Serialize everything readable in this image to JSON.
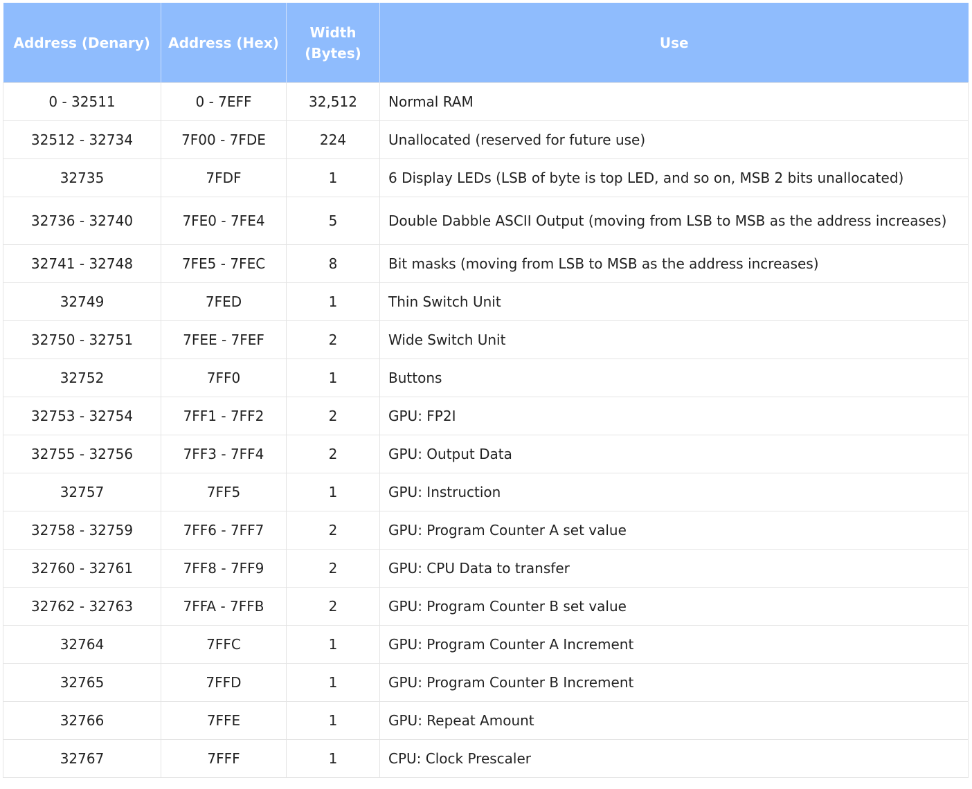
{
  "table": {
    "headers": {
      "denary": "Address (Denary)",
      "hex": "Address (Hex)",
      "width_line1": "Width",
      "width_line2": "(Bytes)",
      "use": "Use"
    },
    "rows": [
      {
        "denary": "0 - 32511",
        "hex": "0 - 7EFF",
        "width": "32,512",
        "use": "Normal RAM"
      },
      {
        "denary": "32512 - 32734",
        "hex": "7F00 - 7FDE",
        "width": "224",
        "use": "Unallocated (reserved for future use)"
      },
      {
        "denary": "32735",
        "hex": "7FDF",
        "width": "1",
        "use": "6 Display LEDs (LSB of byte is top LED, and so on, MSB 2 bits unallocated)"
      },
      {
        "denary": "32736 - 32740",
        "hex": "7FE0 - 7FE4",
        "width": "5",
        "use": "Double Dabble ASCII Output (moving from LSB to MSB as the address increases)"
      },
      {
        "denary": "32741 - 32748",
        "hex": "7FE5 - 7FEC",
        "width": "8",
        "use": "Bit masks (moving from LSB to MSB as the address increases)"
      },
      {
        "denary": "32749",
        "hex": "7FED",
        "width": "1",
        "use": "Thin Switch Unit"
      },
      {
        "denary": "32750 - 32751",
        "hex": "7FEE - 7FEF",
        "width": "2",
        "use": "Wide Switch Unit"
      },
      {
        "denary": "32752",
        "hex": "7FF0",
        "width": "1",
        "use": "Buttons"
      },
      {
        "denary": "32753 - 32754",
        "hex": "7FF1 - 7FF2",
        "width": "2",
        "use": "GPU: FP2I"
      },
      {
        "denary": "32755 - 32756",
        "hex": "7FF3 - 7FF4",
        "width": "2",
        "use": "GPU: Output Data"
      },
      {
        "denary": "32757",
        "hex": "7FF5",
        "width": "1",
        "use": "GPU: Instruction"
      },
      {
        "denary": "32758 - 32759",
        "hex": "7FF6 - 7FF7",
        "width": "2",
        "use": "GPU: Program Counter A set value"
      },
      {
        "denary": "32760 - 32761",
        "hex": "7FF8 - 7FF9",
        "width": "2",
        "use": "GPU: CPU Data to transfer"
      },
      {
        "denary": "32762 - 32763",
        "hex": "7FFA - 7FFB",
        "width": "2",
        "use": "GPU: Program Counter B set value"
      },
      {
        "denary": "32764",
        "hex": "7FFC",
        "width": "1",
        "use": "GPU: Program Counter A Increment"
      },
      {
        "denary": "32765",
        "hex": "7FFD",
        "width": "1",
        "use": "GPU: Program Counter B Increment"
      },
      {
        "denary": "32766",
        "hex": "7FFE",
        "width": "1",
        "use": "GPU: Repeat Amount"
      },
      {
        "denary": "32767",
        "hex": "7FFF",
        "width": "1",
        "use": "CPU: Clock Prescaler"
      }
    ]
  }
}
